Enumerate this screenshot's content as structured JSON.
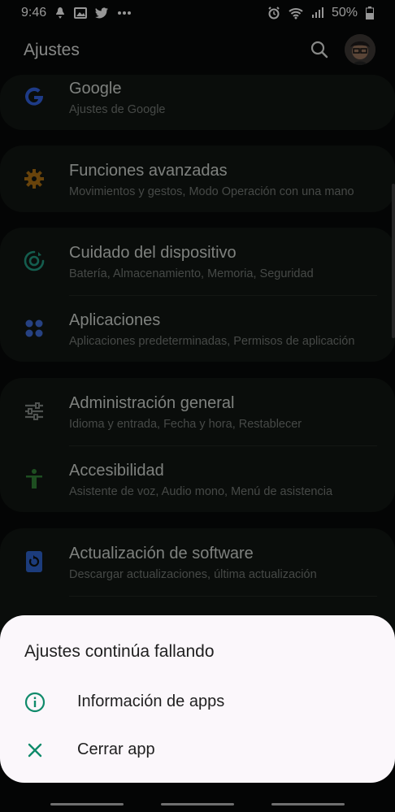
{
  "status_bar": {
    "time": "9:46",
    "battery": "50%",
    "left_icons": [
      "notification-icon",
      "image-icon",
      "twitter-icon",
      "more-dots-icon"
    ],
    "right_icons": [
      "alarm-icon",
      "wifi-icon",
      "signal-icon",
      "battery-icon"
    ]
  },
  "app_bar": {
    "title": "Ajustes"
  },
  "settings": [
    {
      "title": "Google",
      "subtitle": "Ajustes de Google",
      "icon": "google-icon",
      "color": "#2f5bd0"
    },
    {
      "title": "Funciones avanzadas",
      "subtitle": "Movimientos y gestos, Modo Operación con una mano",
      "icon": "gear-icon",
      "color": "#a06812"
    },
    {
      "title": "Cuidado del dispositivo",
      "subtitle": "Batería, Almacenamiento, Memoria, Seguridad",
      "icon": "device-care-icon",
      "color": "#1f8f78"
    },
    {
      "title": "Aplicaciones",
      "subtitle": "Aplicaciones predeterminadas, Permisos de aplicación",
      "icon": "apps-icon",
      "color": "#3b64c8"
    },
    {
      "title": "Administración general",
      "subtitle": "Idioma y entrada, Fecha y hora, Restablecer",
      "icon": "sliders-icon",
      "color": "#7a7f7b"
    },
    {
      "title": "Accesibilidad",
      "subtitle": "Asistente de voz, Audio mono, Menú de asistencia",
      "icon": "accessibility-icon",
      "color": "#2f7a33"
    },
    {
      "title": "Actualización de software",
      "subtitle": "Descargar actualizaciones, última actualización",
      "icon": "software-update-icon",
      "color": "#2b5dbf"
    }
  ],
  "dialog": {
    "title": "Ajustes continúa fallando",
    "options": [
      {
        "label": "Información de apps",
        "icon": "info-icon"
      },
      {
        "label": "Cerrar app",
        "icon": "close-icon"
      }
    ],
    "accent": "#0f8a6a"
  }
}
